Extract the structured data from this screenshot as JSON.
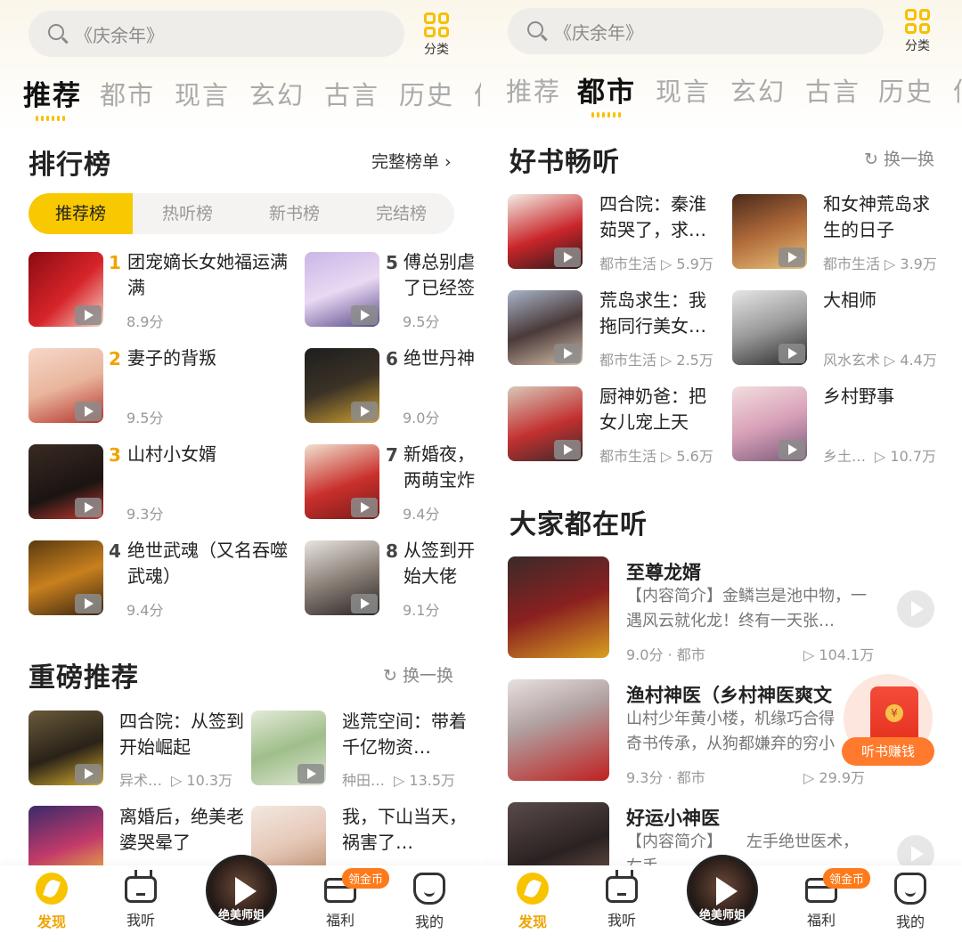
{
  "search": {
    "placeholder": "《庆余年》"
  },
  "category_label": "分类",
  "tabs": [
    "推荐",
    "都市",
    "现言",
    "玄幻",
    "古言",
    "历史",
    "仙"
  ],
  "left": {
    "rank_section": {
      "title": "排行榜",
      "more": "完整榜单 ›",
      "rank_tabs": [
        "推荐榜",
        "热听榜",
        "新书榜",
        "完结榜"
      ],
      "items": [
        {
          "num": "1",
          "title": "团宠嫡长女她福运满满",
          "score": "8.9分"
        },
        {
          "num": "2",
          "title": "妻子的背叛",
          "score": "9.5分"
        },
        {
          "num": "3",
          "title": "山村小女婿",
          "score": "9.3分"
        },
        {
          "num": "4",
          "title": "绝世武魂（又名吞噬武魂）",
          "score": "9.4分"
        },
        {
          "num": "5",
          "title": "傅总别虐了已经签了",
          "score": "9.5分"
        },
        {
          "num": "6",
          "title": "绝世丹神",
          "score": "9.0分"
        },
        {
          "num": "7",
          "title": "新婚夜，两萌宝炸",
          "score": "9.4分"
        },
        {
          "num": "8",
          "title": "从签到开始大佬",
          "score": "9.1分"
        }
      ]
    },
    "heavy_section": {
      "title": "重磅推荐",
      "refresh": "换一换",
      "items": [
        {
          "title": "四合院：从签到开始崛起",
          "tag": "异术…",
          "plays": "▷ 10.3万"
        },
        {
          "title": "逃荒空间：带着千亿物资…",
          "tag": "种田…",
          "plays": "▷ 13.5万"
        },
        {
          "title": "离婚后，绝美老婆哭晕了",
          "tag": "",
          "plays": ""
        },
        {
          "title": "我，下山当天，祸害了…",
          "tag": "",
          "plays": ""
        }
      ]
    }
  },
  "right": {
    "good_section": {
      "title": "好书畅听",
      "refresh": "换一换",
      "items": [
        {
          "title": "四合院：秦淮茹哭了，求…",
          "tag": "都市生活",
          "plays": "▷ 5.9万"
        },
        {
          "title": "和女神荒岛求生的日子",
          "tag": "都市生活",
          "plays": "▷ 3.9万"
        },
        {
          "title": "荒岛求生：我拖同行美女…",
          "tag": "都市生活",
          "plays": "▷ 2.5万"
        },
        {
          "title": "大相师",
          "tag": "风水玄术",
          "plays": "▷ 4.4万"
        },
        {
          "title": "厨神奶爸：把女儿宠上天",
          "tag": "都市生活",
          "plays": "▷ 5.6万"
        },
        {
          "title": "乡村野事",
          "tag": "乡土…",
          "plays": "▷ 10.7万"
        }
      ]
    },
    "all_section": {
      "title": "大家都在听",
      "items": [
        {
          "title": "至尊龙婿",
          "desc": "【内容简介】金鳞岂是池中物，一遇风云就化龙！终有一天张…",
          "meta": "9.0分 · 都市",
          "plays": "▷ 104.1万"
        },
        {
          "title": "渔村神医（乡村神医爽文",
          "desc": "山村少年黄小楼，机缘巧合得奇书传承，从狗都嫌弃的穷小",
          "meta": "9.3分 · 都市",
          "plays": "▷ 29.9万"
        },
        {
          "title": "好运小神医",
          "desc": "【内容简介】　　左手绝世医术，右手…　　金蛋",
          "meta": "",
          "plays": ""
        }
      ]
    },
    "float_gift_label": "听书赚钱"
  },
  "bottom_nav": {
    "items": [
      "发现",
      "我听",
      "福利",
      "我的"
    ],
    "gold_badge": "领金币",
    "disc_text": "绝美师姐"
  },
  "colors": {
    "accent": "#f8c800",
    "rank_num": "#f0a400",
    "badge": "#ff7a1a"
  }
}
